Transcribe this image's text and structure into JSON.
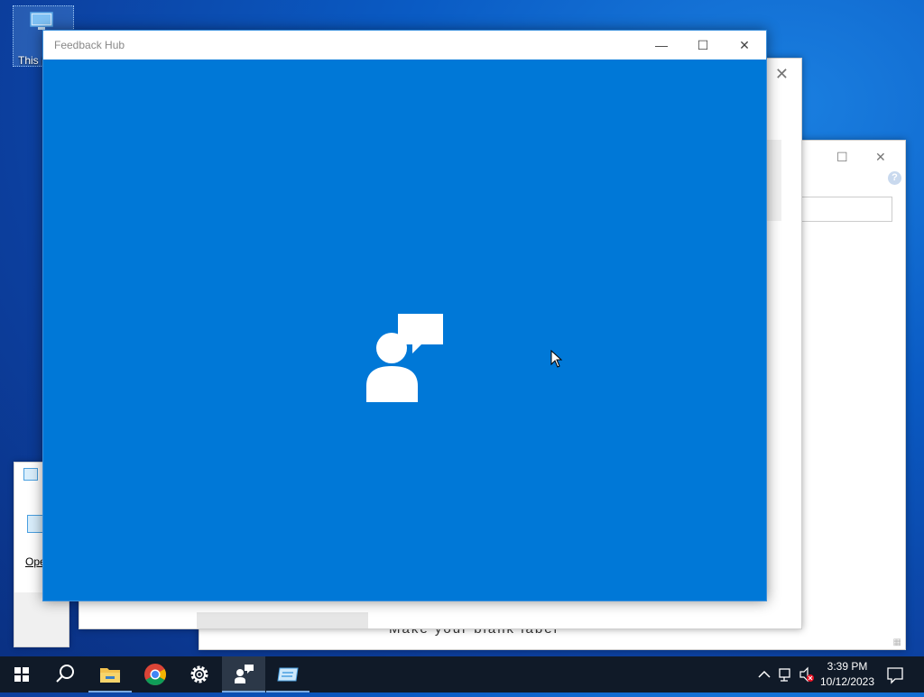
{
  "desktop": {
    "icon_label": "This PC"
  },
  "background_windows": {
    "win1_link_text": "Ope",
    "win3_bottom_text": "Make your blank label",
    "win3_help_glyph": "?"
  },
  "feedback_hub": {
    "title": "Feedback Hub",
    "minimize_glyph": "—",
    "maximize_glyph": "☐",
    "close_glyph": "✕",
    "splash_color": "#0078d7"
  },
  "taskbar": {
    "items": [
      {
        "name": "start-button",
        "icon": "windows-logo-icon"
      },
      {
        "name": "search-button",
        "icon": "search-icon"
      },
      {
        "name": "file-explorer",
        "icon": "folder-icon"
      },
      {
        "name": "chrome",
        "icon": "chrome-icon"
      },
      {
        "name": "settings",
        "icon": "gear-icon"
      },
      {
        "name": "feedback-hub",
        "icon": "feedback-icon"
      },
      {
        "name": "app-window",
        "icon": "window-app-icon"
      }
    ],
    "time": "3:39 PM",
    "date": "10/12/2023"
  },
  "colors": {
    "accent": "#0078d7",
    "taskbar": "#101a28"
  }
}
